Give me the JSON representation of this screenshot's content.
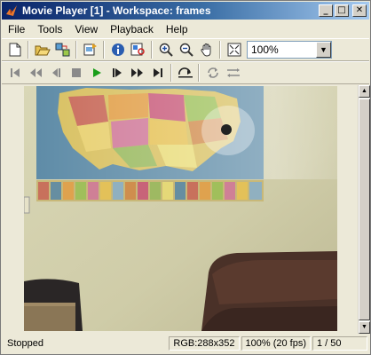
{
  "window": {
    "title": "Movie Player [1] - Workspace: frames"
  },
  "title_buttons": {
    "minimize": "_",
    "maximize": "□",
    "close": "✕"
  },
  "menu": [
    "File",
    "Tools",
    "View",
    "Playback",
    "Help"
  ],
  "toolbar1": {
    "icons": [
      "new-icon",
      "open-icon",
      "export-icon",
      "import-workspace-icon",
      "info-icon",
      "pixel-region-icon",
      "zoom-in-icon",
      "zoom-out-icon",
      "pan-hand-icon",
      "fit-to-window-icon"
    ],
    "zoom": {
      "value": "100%"
    }
  },
  "toolbar2": {
    "icons": [
      "go-to-first-icon",
      "rewind-icon",
      "step-back-icon",
      "stop-icon",
      "play-icon",
      "step-forward-icon",
      "fast-forward-icon",
      "go-to-last-icon",
      "jump-to-icon",
      "repeat-icon",
      "forward-backward-icon"
    ],
    "colors": {
      "play": "#1a9e1a",
      "disabled": "#8a8a8a"
    }
  },
  "status": {
    "state": "Stopped",
    "image_info": "RGB:288x352",
    "zoom_fps": "100% (20 fps)",
    "frame": "1 / 50"
  },
  "colors": {
    "titlebar_start": "#0a246a",
    "titlebar_end": "#a6caf0",
    "face": "#ece9d8"
  }
}
